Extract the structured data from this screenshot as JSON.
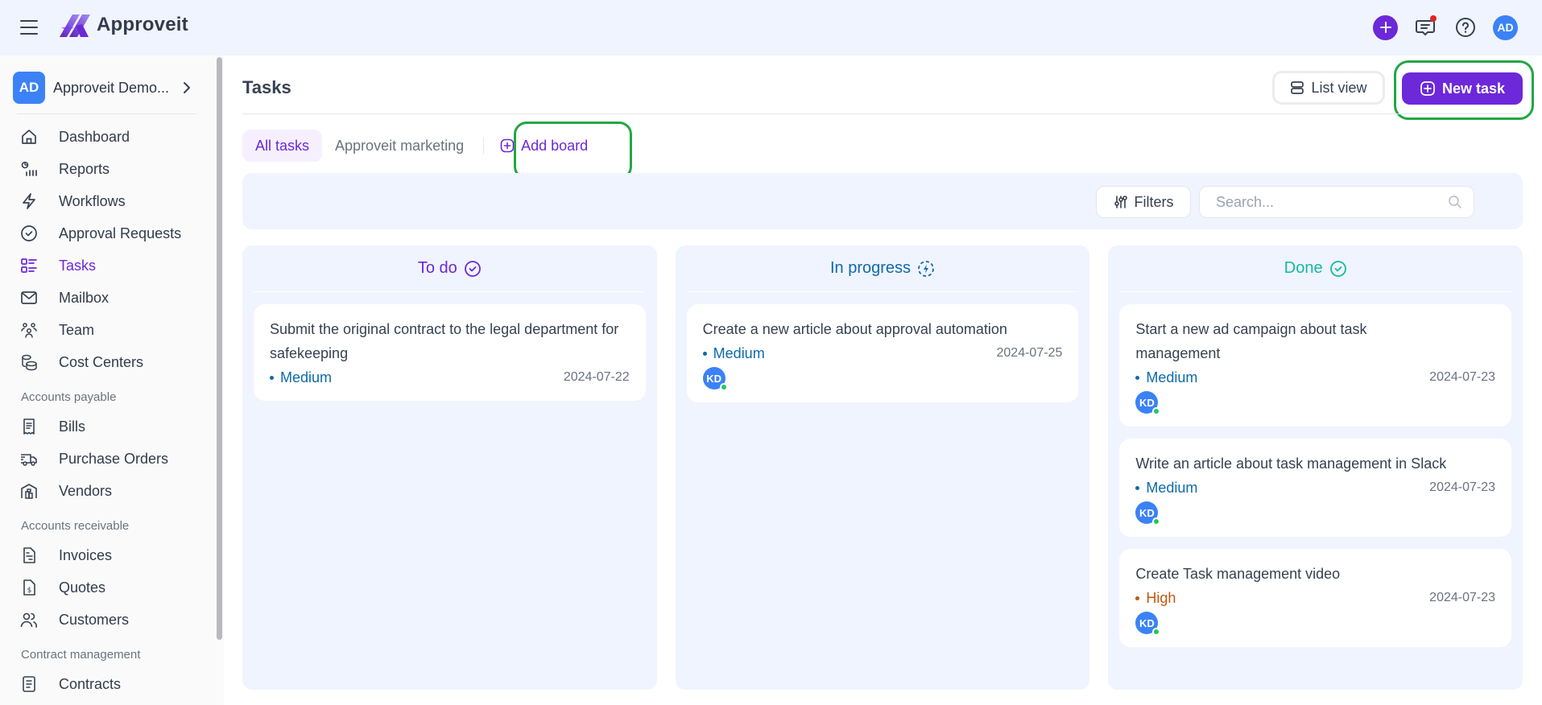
{
  "app": {
    "name": "Approveit",
    "user_initials": "AD",
    "has_notification": true
  },
  "colors": {
    "brand": "#6d28d9",
    "todo": "#6d28d9",
    "in_progress": "#0e6aa8",
    "done": "#14b8a6",
    "medium": "#0e6aa8",
    "high": "#c2570c",
    "avatar": "#3b82f6",
    "annotation": "#22a745"
  },
  "sidebar": {
    "org": {
      "initials": "AD",
      "name": "Approveit Demo..."
    },
    "items": [
      {
        "label": "Dashboard",
        "icon": "home-icon"
      },
      {
        "label": "Reports",
        "icon": "reports-icon"
      },
      {
        "label": "Workflows",
        "icon": "lightning-icon"
      },
      {
        "label": "Approval Requests",
        "icon": "check-circle-icon"
      },
      {
        "label": "Tasks",
        "icon": "tasks-icon",
        "active": true
      },
      {
        "label": "Mailbox",
        "icon": "mail-icon"
      },
      {
        "label": "Team",
        "icon": "team-icon"
      },
      {
        "label": "Cost Centers",
        "icon": "database-icon"
      }
    ],
    "sections": [
      {
        "title": "Accounts payable",
        "items": [
          {
            "label": "Bills",
            "icon": "receipt-icon"
          },
          {
            "label": "Purchase Orders",
            "icon": "truck-icon"
          },
          {
            "label": "Vendors",
            "icon": "warehouse-icon"
          }
        ]
      },
      {
        "title": "Accounts receivable",
        "items": [
          {
            "label": "Invoices",
            "icon": "invoice-icon"
          },
          {
            "label": "Quotes",
            "icon": "dollar-document-icon"
          },
          {
            "label": "Customers",
            "icon": "users-icon"
          }
        ]
      },
      {
        "title": "Contract management",
        "items": [
          {
            "label": "Contracts",
            "icon": "contract-icon"
          }
        ]
      }
    ]
  },
  "main": {
    "title": "Tasks",
    "list_view_label": "List view",
    "new_task_label": "New task",
    "tabs": [
      {
        "label": "All tasks",
        "active": true
      },
      {
        "label": "Approveit marketing",
        "active": false
      }
    ],
    "add_board_label": "Add board",
    "filters_label": "Filters",
    "search": {
      "placeholder": "Search...",
      "value": ""
    },
    "columns": [
      {
        "title": "To do",
        "icon": "check-circle-icon",
        "cards": [
          {
            "title": "Submit the original contract to the legal department for safekeeping",
            "priority": "Medium",
            "due": "2024-07-22",
            "assignee": null
          }
        ]
      },
      {
        "title": "In progress",
        "icon": "progress-lightning-icon",
        "cards": [
          {
            "title": "Create a new article about approval automation",
            "priority": "Medium",
            "due": "2024-07-25",
            "assignee": "KD"
          }
        ]
      },
      {
        "title": "Done",
        "icon": "check-circle-icon",
        "cards": [
          {
            "title": "Start a new ad campaign about task management",
            "priority": "Medium",
            "due": "2024-07-23",
            "assignee": "KD"
          },
          {
            "title": "Write an article about task management in Slack",
            "priority": "Medium",
            "due": "2024-07-23",
            "assignee": "KD"
          },
          {
            "title": "Create Task management video",
            "priority": "High",
            "due": "2024-07-23",
            "assignee": "KD"
          }
        ]
      }
    ]
  }
}
